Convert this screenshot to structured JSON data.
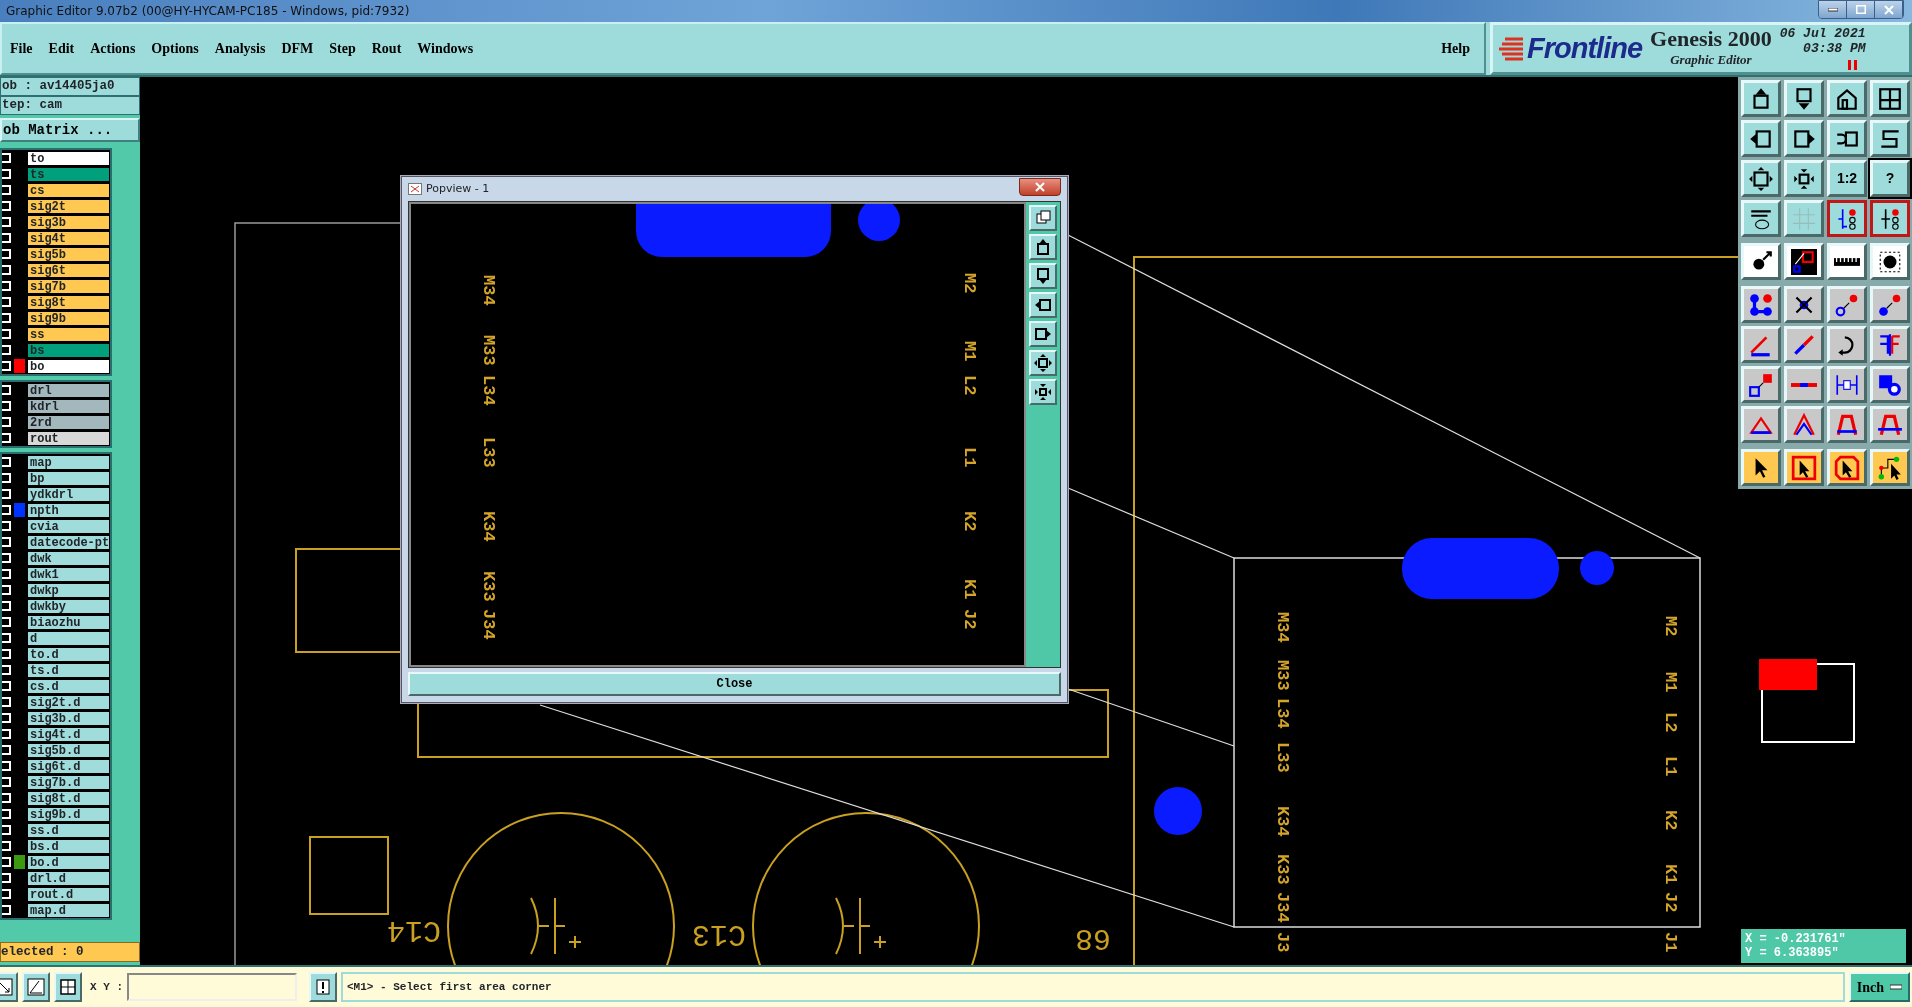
{
  "window": {
    "title": "Graphic Editor 9.07b2 (00@HY-HYCAM-PC185 - Windows, pid:7932)"
  },
  "menu": [
    "File",
    "Edit",
    "Actions",
    "Options",
    "Analysis",
    "DFM",
    "Step",
    "Rout",
    "Windows"
  ],
  "help": "Help",
  "brand": {
    "logo": "Frontline",
    "product": "Genesis 2000",
    "subtitle": "Graphic Editor",
    "date": "06 Jul 2021",
    "time": "03:38 PM"
  },
  "job": {
    "job_line": "ob : av14405ja0",
    "step_line": "tep: cam",
    "matrix_button": "ob Matrix ..."
  },
  "layer_groups": [
    [
      {
        "name": "to",
        "color": "#ffffff",
        "checked": false
      },
      {
        "name": "ts",
        "color": "#00a07c",
        "checked": false
      },
      {
        "name": "cs",
        "color": "#ffc850",
        "checked": false
      },
      {
        "name": "sig2t",
        "color": "#ffc850",
        "checked": false
      },
      {
        "name": "sig3b",
        "color": "#ffc850",
        "checked": false
      },
      {
        "name": "sig4t",
        "color": "#ffc850",
        "checked": false
      },
      {
        "name": "sig5b",
        "color": "#ffc850",
        "checked": false
      },
      {
        "name": "sig6t",
        "color": "#ffc850",
        "checked": false
      },
      {
        "name": "sig7b",
        "color": "#ffc850",
        "checked": false
      },
      {
        "name": "sig8t",
        "color": "#ffc850",
        "checked": false
      },
      {
        "name": "sig9b",
        "color": "#ffc850",
        "checked": false
      },
      {
        "name": "ss",
        "color": "#ffc850",
        "checked": false
      },
      {
        "name": "bs",
        "color": "#00a07c",
        "checked": false
      },
      {
        "name": "bo",
        "color": "#ffffff",
        "checked": false,
        "display": {
          "color": "#ff0000"
        }
      }
    ],
    [
      {
        "name": "drl",
        "color": "#a2b8bc",
        "checked": false
      },
      {
        "name": "kdrl",
        "color": "#a2b8bc",
        "checked": false
      },
      {
        "name": "2rd",
        "color": "#a2b8bc",
        "checked": false
      },
      {
        "name": "rout",
        "color": "#d8d8d8",
        "checked": false
      }
    ],
    [
      {
        "name": "map",
        "color": "#a0dcdc",
        "checked": false
      },
      {
        "name": "bp",
        "color": "#a0dcdc",
        "checked": false
      },
      {
        "name": "ydkdrl",
        "color": "#a0dcdc",
        "checked": false
      },
      {
        "name": "npth",
        "color": "#a0dcdc",
        "checked": false,
        "display": {
          "color": "#0033ff"
        }
      },
      {
        "name": "cvia",
        "color": "#a0dcdc",
        "checked": false
      },
      {
        "name": "datecode-pt",
        "color": "#a0dcdc",
        "checked": false
      },
      {
        "name": "dwk",
        "color": "#a0dcdc",
        "checked": false
      },
      {
        "name": "dwk1",
        "color": "#a0dcdc",
        "checked": false
      },
      {
        "name": "dwkp",
        "color": "#a0dcdc",
        "checked": false
      },
      {
        "name": "dwkby",
        "color": "#a0dcdc",
        "checked": false
      },
      {
        "name": "biaozhu",
        "color": "#a0dcdc",
        "checked": false
      },
      {
        "name": "d",
        "color": "#a0dcdc",
        "checked": false
      },
      {
        "name": "to.d",
        "color": "#a0dcdc",
        "checked": false
      },
      {
        "name": "ts.d",
        "color": "#a0dcdc",
        "checked": false
      },
      {
        "name": "cs.d",
        "color": "#a0dcdc",
        "checked": false
      },
      {
        "name": "sig2t.d",
        "color": "#a0dcdc",
        "checked": false
      },
      {
        "name": "sig3b.d",
        "color": "#a0dcdc",
        "checked": false
      },
      {
        "name": "sig4t.d",
        "color": "#a0dcdc",
        "checked": false
      },
      {
        "name": "sig5b.d",
        "color": "#a0dcdc",
        "checked": false
      },
      {
        "name": "sig6t.d",
        "color": "#a0dcdc",
        "checked": false
      },
      {
        "name": "sig7b.d",
        "color": "#a0dcdc",
        "checked": false
      },
      {
        "name": "sig8t.d",
        "color": "#a0dcdc",
        "checked": false
      },
      {
        "name": "sig9b.d",
        "color": "#a0dcdc",
        "checked": false
      },
      {
        "name": "ss.d",
        "color": "#a0dcdc",
        "checked": false
      },
      {
        "name": "bs.d",
        "color": "#a0dcdc",
        "checked": false
      },
      {
        "name": "bo.d",
        "color": "#a0dcdc",
        "checked": false,
        "display": {
          "color": "#3c9a10"
        }
      },
      {
        "name": "drl.d",
        "color": "#a0dcdc",
        "checked": false
      },
      {
        "name": "rout.d",
        "color": "#a0dcdc",
        "checked": false
      },
      {
        "name": "map.d",
        "color": "#a0dcdc",
        "checked": false
      }
    ]
  ],
  "selected_count": "elected : 0",
  "popview": {
    "title": "Popview - 1",
    "left_labels": [
      "M34",
      "M33",
      "L34",
      "L33",
      "K34",
      "K33",
      "J34"
    ],
    "right_labels": [
      "M2",
      "M1",
      "L2",
      "L1",
      "K2",
      "K1",
      "J2"
    ],
    "close_button": "Close"
  },
  "zoom_view": {
    "left_labels": [
      "M34",
      "M33",
      "L34",
      "L33",
      "K34",
      "K33",
      "J34",
      "J3"
    ],
    "right_labels": [
      "M2",
      "M1",
      "L2",
      "L1",
      "K2",
      "K1",
      "J2",
      "J1"
    ]
  },
  "canvas_labels": [
    "C14",
    "C13",
    "68"
  ],
  "tool_groups": [
    {
      "kind": "view",
      "tools": [
        {
          "active": false
        },
        {
          "active": false
        },
        {
          "active": false
        },
        {
          "active": false
        },
        {
          "active": false
        },
        {
          "active": false
        },
        {
          "active": false
        },
        {
          "active": false
        },
        {
          "active": false
        },
        {
          "active": false
        },
        {
          "active": false,
          "label": "1:2"
        },
        {
          "active": false,
          "label": "?"
        },
        {
          "active": false
        },
        {
          "active": false
        },
        {
          "active": true
        },
        {
          "active": true
        }
      ]
    },
    {
      "kind": "display",
      "tools": [
        {
          "active": false
        },
        {
          "active": false
        },
        {
          "active": false
        },
        {
          "active": false
        }
      ]
    },
    {
      "kind": "edit",
      "tools": [
        {
          "active": false
        },
        {
          "active": false
        },
        {
          "active": false
        },
        {
          "active": false
        },
        {
          "active": false
        },
        {
          "active": false
        },
        {
          "active": false
        },
        {
          "active": false
        },
        {
          "active": false
        },
        {
          "active": false
        },
        {
          "active": false
        },
        {
          "active": false
        },
        {
          "active": false
        },
        {
          "active": false
        },
        {
          "active": false
        },
        {
          "active": false
        }
      ]
    },
    {
      "kind": "select",
      "tools": [
        {
          "active": false
        },
        {
          "active": false
        },
        {
          "active": false
        },
        {
          "active": false
        }
      ]
    }
  ],
  "coordinates": {
    "x": "X = -0.231761\"",
    "y": "Y = 6.363895\""
  },
  "status_bar": {
    "xy_label": "X Y :",
    "message": "<M1> - Select first area corner",
    "units": "Inch"
  }
}
